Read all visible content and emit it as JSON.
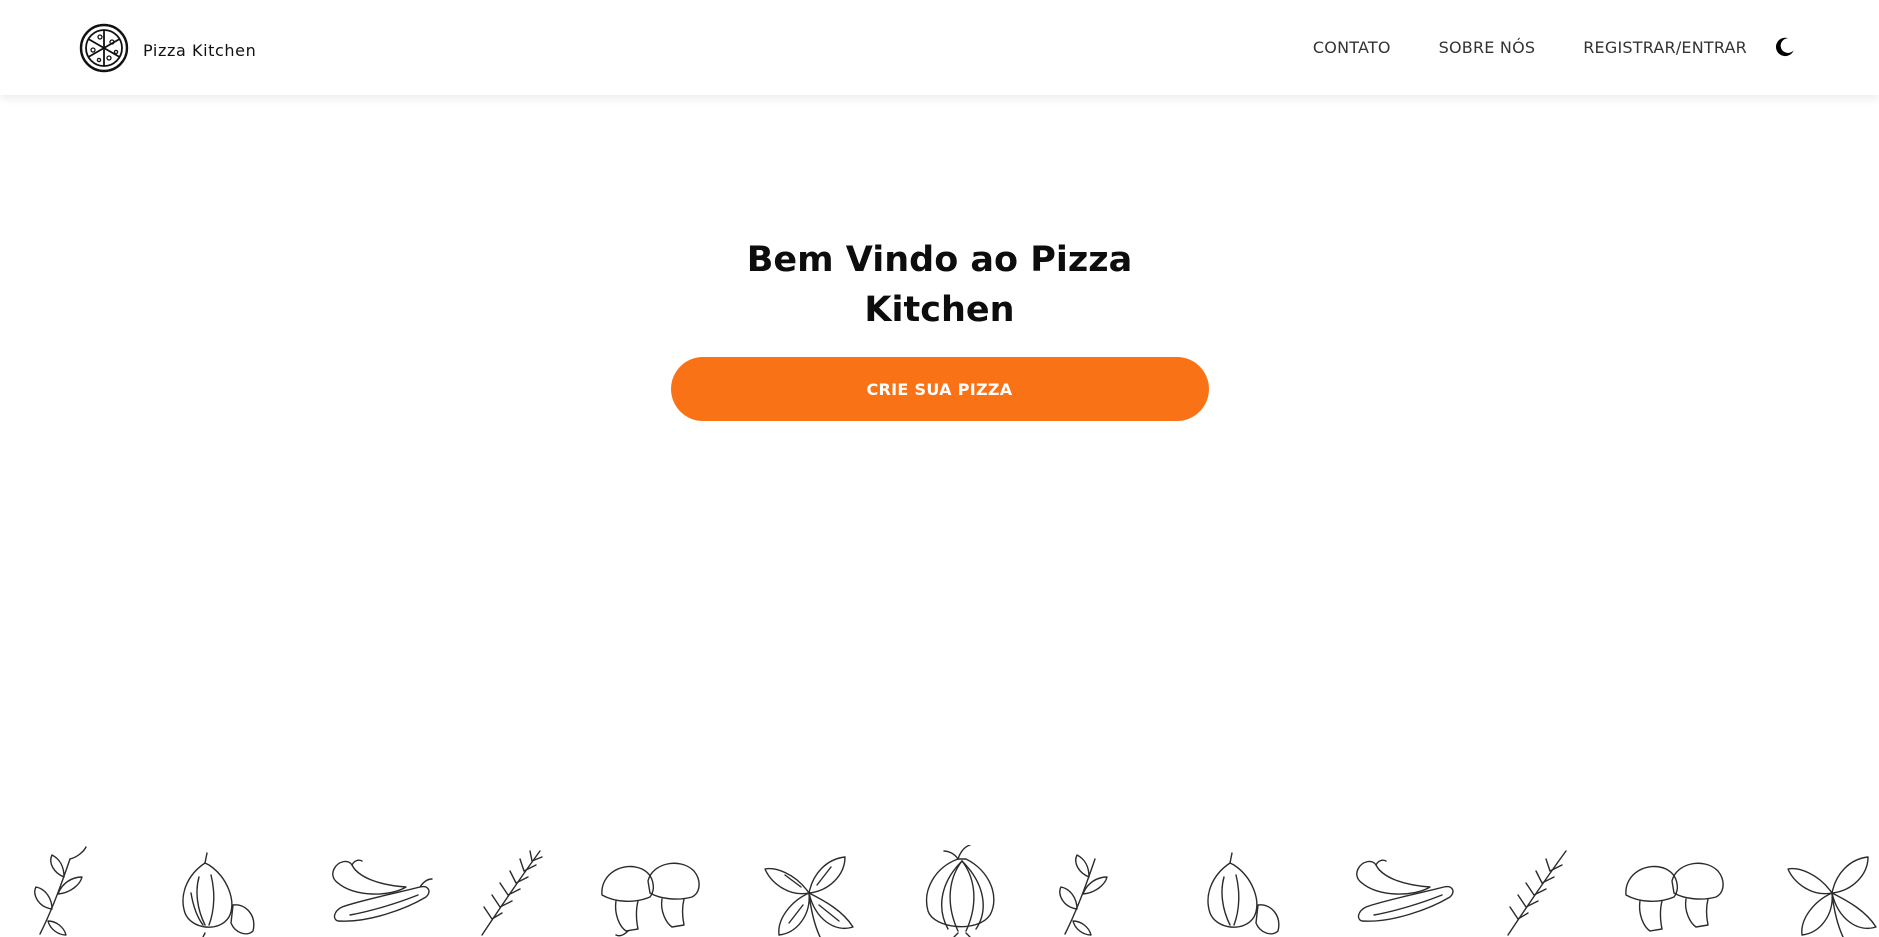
{
  "brand": {
    "name": "Pizza Kitchen",
    "logo_icon": "pizza-icon"
  },
  "nav": {
    "items": [
      {
        "label": "CONTATO"
      },
      {
        "label": "SOBRE NÓS"
      },
      {
        "label": "REGISTRAR/ENTRAR"
      }
    ],
    "theme_icon": "moon-icon"
  },
  "hero": {
    "title": "Bem Vindo ao Pizza Kitchen",
    "cta_label": "CRIE SUA PIZZA"
  },
  "colors": {
    "accent": "#f97316",
    "text": "#0d0d0d",
    "sketch": "#2b2b2b"
  },
  "ingredients": {
    "icons": [
      "basil-sprig-icon",
      "garlic-icon",
      "chili-pepper-icon",
      "rosemary-icon",
      "mushroom-icon",
      "basil-leaves-icon",
      "onion-icon",
      "basil-sprig-icon",
      "garlic-icon",
      "chili-pepper-icon",
      "rosemary-icon",
      "mushroom-icon",
      "basil-leaves-icon"
    ]
  }
}
